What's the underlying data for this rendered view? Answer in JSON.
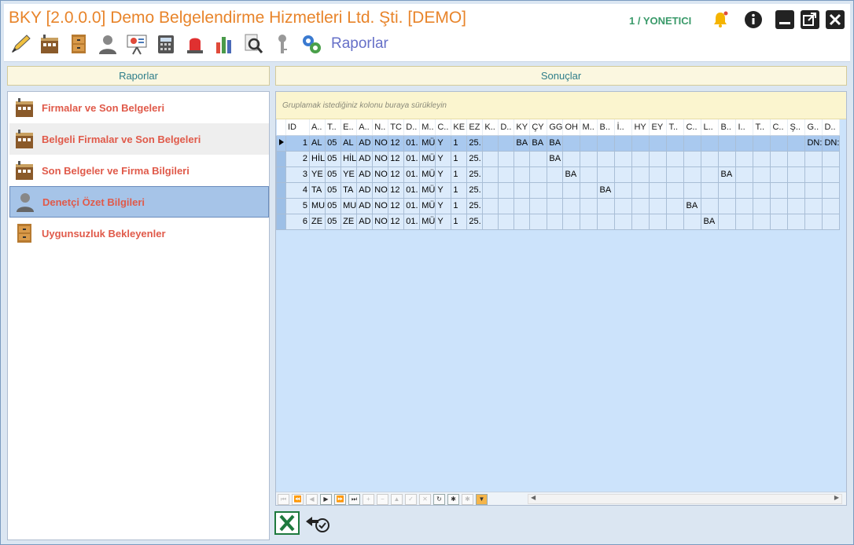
{
  "window": {
    "title": "BKY [2.0.0.0] Demo Belgelendirme Hizmetleri Ltd. Şti. [DEMO]",
    "user": "1 / YONETICI"
  },
  "toolbar": {
    "icons": [
      "pen-icon",
      "building-icon",
      "cabinet-icon",
      "person-icon",
      "presentation-icon",
      "calculator-icon",
      "alarm-light-icon",
      "bar-chart-icon",
      "magnifier-icon",
      "key-icon",
      "gears-icon"
    ],
    "title": "Raporlar"
  },
  "left": {
    "header": "Raporlar",
    "items": [
      {
        "label": "Firmalar ve Son Belgeleri",
        "icon": "building-icon"
      },
      {
        "label": "Belgeli Firmalar ve Son Belgeleri",
        "icon": "building-icon"
      },
      {
        "label": "Son Belgeler ve Firma Bilgileri",
        "icon": "building-icon"
      },
      {
        "label": "Denetçi Özet Bilgileri",
        "icon": "person-icon"
      },
      {
        "label": "Uygunsuzluk Bekleyenler",
        "icon": "cabinet-icon"
      }
    ]
  },
  "right": {
    "header": "Sonuçlar",
    "group_hint": "Gruplamak istediğiniz kolonu buraya sürükleyin",
    "columns": [
      "ID",
      "A..",
      "T..",
      "E..",
      "A..",
      "N..",
      "TC",
      "D..",
      "M..",
      "C..",
      "KE",
      "EZ",
      "K..",
      "D..",
      "KY",
      "ÇY",
      "GG",
      "OH",
      "M..",
      "B..",
      "İ..",
      "HY",
      "EY",
      "T..",
      "C..",
      "L..",
      "B..",
      "I..",
      "T..",
      "C..",
      "Ş..",
      "G..",
      "D.."
    ],
    "rows": [
      [
        "1",
        "AL",
        "05",
        "AL",
        "AD",
        "NO",
        "12",
        "01.",
        "MÜ",
        "Y",
        "1",
        "25.",
        "",
        "",
        "BA",
        "BA",
        "BA",
        "",
        "",
        "",
        "",
        "",
        "",
        "",
        "",
        "",
        "",
        "",
        "",
        "",
        "",
        "DN:",
        "DN:"
      ],
      [
        "2",
        "HİL",
        "05",
        "HİL",
        "AD",
        "NO",
        "12",
        "01.",
        "MÜ",
        "Y",
        "1",
        "25.",
        "",
        "",
        "",
        "",
        "BA",
        "",
        "",
        "",
        "",
        "",
        "",
        "",
        "",
        "",
        "",
        "",
        "",
        "",
        "",
        "",
        ""
      ],
      [
        "3",
        "YE",
        "05",
        "YE",
        "AD",
        "NO",
        "12",
        "01.",
        "MÜ",
        "Y",
        "1",
        "25.",
        "",
        "",
        "",
        "",
        "",
        "BA",
        "",
        "",
        "",
        "",
        "",
        "",
        "",
        "",
        "BA",
        "",
        "",
        "",
        "",
        "",
        ""
      ],
      [
        "4",
        "TA",
        "05",
        "TA",
        "AD",
        "NO",
        "12",
        "01.",
        "MÜ",
        "Y",
        "1",
        "25.",
        "",
        "",
        "",
        "",
        "",
        "",
        "",
        "BA",
        "",
        "",
        "",
        "",
        "",
        "",
        "",
        "",
        "",
        "",
        "",
        "",
        ""
      ],
      [
        "5",
        "MU",
        "05",
        "MU",
        "AD",
        "NO",
        "12",
        "01.",
        "MÜ",
        "Y",
        "1",
        "25.",
        "",
        "",
        "",
        "",
        "",
        "",
        "",
        "",
        "",
        "",
        "",
        "",
        "BA",
        "",
        "",
        "",
        "",
        "",
        "",
        "",
        ""
      ],
      [
        "6",
        "ZE",
        "05",
        "ZE",
        "AD",
        "NO",
        "12",
        "01.",
        "MÜ",
        "Y",
        "1",
        "25.",
        "",
        "",
        "",
        "",
        "",
        "",
        "",
        "",
        "",
        "",
        "",
        "",
        "",
        "BA",
        "",
        "",
        "",
        "",
        "",
        "",
        ""
      ]
    ],
    "selected_row": 0
  },
  "bottom": {
    "icons": [
      "excel-export-icon",
      "refresh-check-icon"
    ]
  },
  "colors": {
    "title_orange": "#e8842a",
    "user_green": "#3a9a6a",
    "report_red": "#e05a4a",
    "toolbar_purple": "#6670c8",
    "header_teal": "#2e7d8a"
  }
}
